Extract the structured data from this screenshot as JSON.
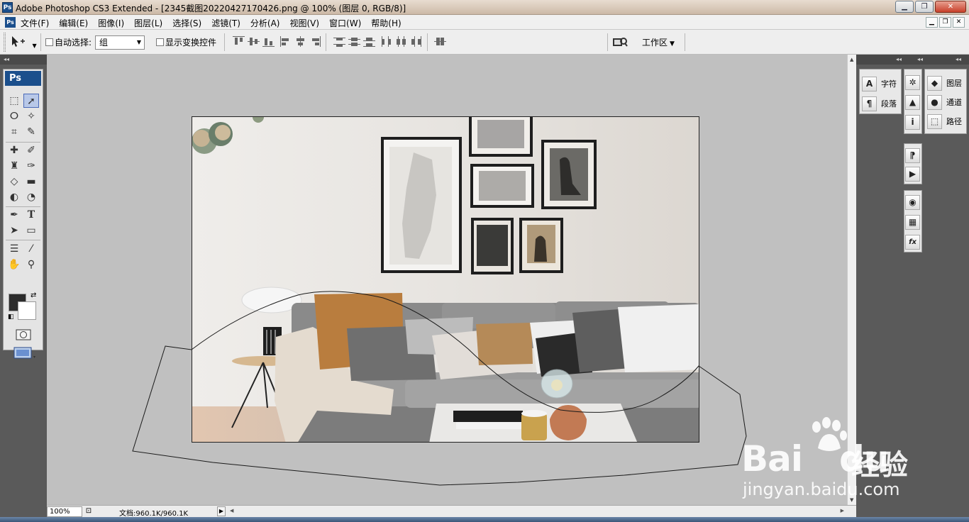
{
  "window": {
    "logo": "Ps",
    "title": "Adobe Photoshop CS3 Extended - [2345截图20220427170426.png @ 100% (图层 0, RGB/8)]",
    "minimize": "▁",
    "restore": "❐",
    "close": "✕"
  },
  "menu": {
    "logo": "Ps",
    "items": [
      "文件(F)",
      "编辑(E)",
      "图像(I)",
      "图层(L)",
      "选择(S)",
      "滤镜(T)",
      "分析(A)",
      "视图(V)",
      "窗口(W)",
      "帮助(H)"
    ],
    "doc_minimize": "▁",
    "doc_restore": "❐",
    "doc_close": "✕"
  },
  "options": {
    "auto_select_label": "自动选择:",
    "auto_select_checked": false,
    "auto_select_value": "组",
    "show_transform_label": "显示变换控件",
    "show_transform_checked": false,
    "workspace_label": "工作区"
  },
  "toolbox": {
    "logo": "Ps",
    "collapse": "◂◂",
    "foreground_color": "#2c2c2c",
    "background_color": "#ffffff"
  },
  "right_panels": {
    "collapse": "◂◂",
    "col1": [
      {
        "label": "字符",
        "icon": "character-icon",
        "glyph": "A"
      },
      {
        "label": "段落",
        "icon": "paragraph-icon",
        "glyph": "¶"
      }
    ],
    "col2": [
      {
        "icon": "navigator-icon",
        "glyph": "✲"
      },
      {
        "icon": "histogram-icon",
        "glyph": "▲"
      },
      {
        "icon": "info-icon",
        "glyph": "i"
      },
      {
        "icon": "history-icon",
        "glyph": "⁋"
      },
      {
        "icon": "actions-icon",
        "glyph": "▶"
      },
      {
        "icon": "color-icon",
        "glyph": "◉"
      },
      {
        "icon": "swatches-icon",
        "glyph": "▦"
      },
      {
        "icon": "styles-icon",
        "glyph": "fx"
      }
    ],
    "col3": [
      {
        "label": "图层",
        "icon": "layers-icon",
        "glyph": "◆"
      },
      {
        "label": "通道",
        "icon": "channels-icon",
        "glyph": "●"
      },
      {
        "label": "路径",
        "icon": "paths-icon",
        "glyph": "⬚"
      }
    ]
  },
  "status": {
    "zoom": "100%",
    "doc_info": "文档:960.1K/960.1K"
  },
  "watermark": {
    "brand": "Bai",
    "brand2": "du",
    "cn": "经验",
    "url": "jingyan.baidu.com"
  },
  "colors": {
    "panel_dark": "#5a5a5a",
    "canvas_bg": "#c0c0c0",
    "accent_blue": "#1b4f8c",
    "wall": "#e6e3df",
    "sofa": "#8c8c8c",
    "pillow_orange": "#b97d3e"
  }
}
